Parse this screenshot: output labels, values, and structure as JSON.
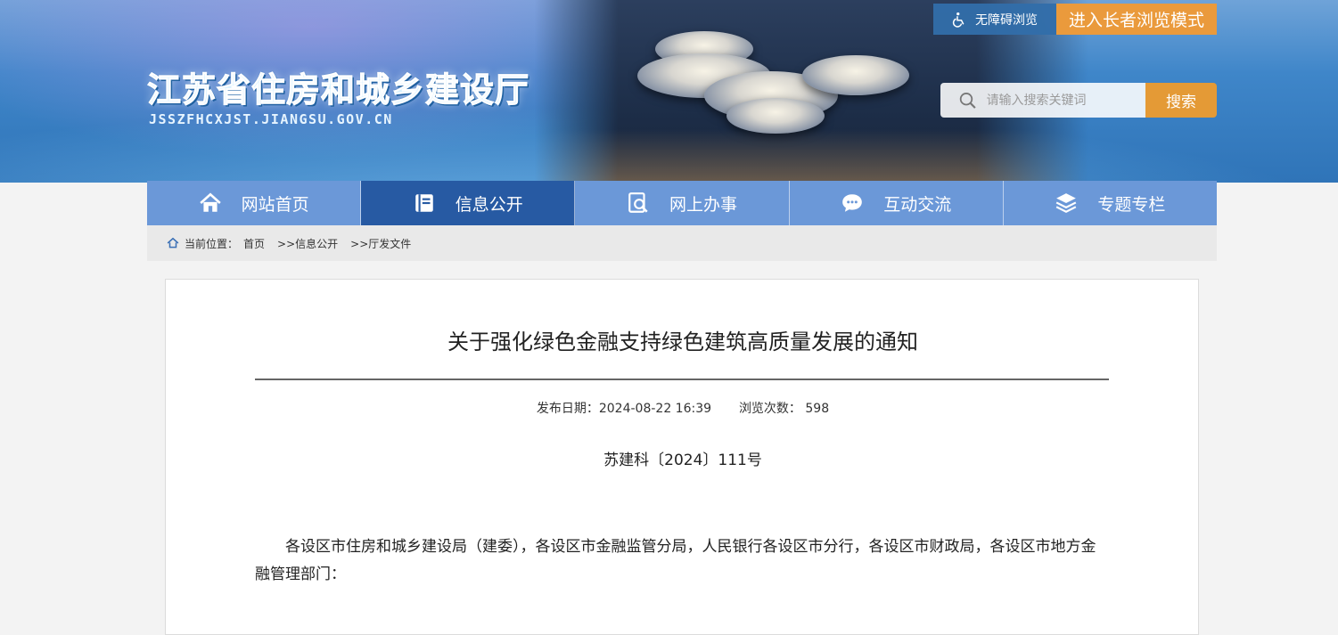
{
  "header": {
    "site_title": "江苏省住房和城乡建设厅",
    "site_domain": "JSSZFHCXJST.JIANGSU.GOV.CN",
    "accessibility_label": "无障碍浏览",
    "elder_mode_label": "进入长者浏览模式",
    "search_placeholder": "请输入搜索关键词",
    "search_button": "搜索"
  },
  "nav": {
    "items": [
      {
        "label": "网站首页",
        "icon": "home-icon"
      },
      {
        "label": "信息公开",
        "icon": "book-icon",
        "active": true
      },
      {
        "label": "网上办事",
        "icon": "document-search-icon"
      },
      {
        "label": "互动交流",
        "icon": "chat-icon"
      },
      {
        "label": "专题专栏",
        "icon": "layers-icon"
      }
    ]
  },
  "breadcrumb": {
    "prefix": "当前位置：",
    "items": [
      "首页",
      ">>信息公开",
      ">>厅发文件"
    ]
  },
  "article": {
    "title": "关于强化绿色金融支持绿色建筑高质量发展的通知",
    "publish_label": "发布日期：",
    "publish_date": "2024-08-22 16:39",
    "views_label": "浏览次数：",
    "views": "598",
    "doc_number": "苏建科〔2024〕111号",
    "body": "各设区市住房和城乡建设局（建委），各设区市金融监管分局，人民银行各设区市分行，各设区市财政局，各设区市地方金融管理部门："
  },
  "colors": {
    "nav_bg": "#6b98d8",
    "nav_active": "#275aa3",
    "accent_orange": "#e49a36",
    "breadcrumb_bg": "#e9e9e9"
  }
}
